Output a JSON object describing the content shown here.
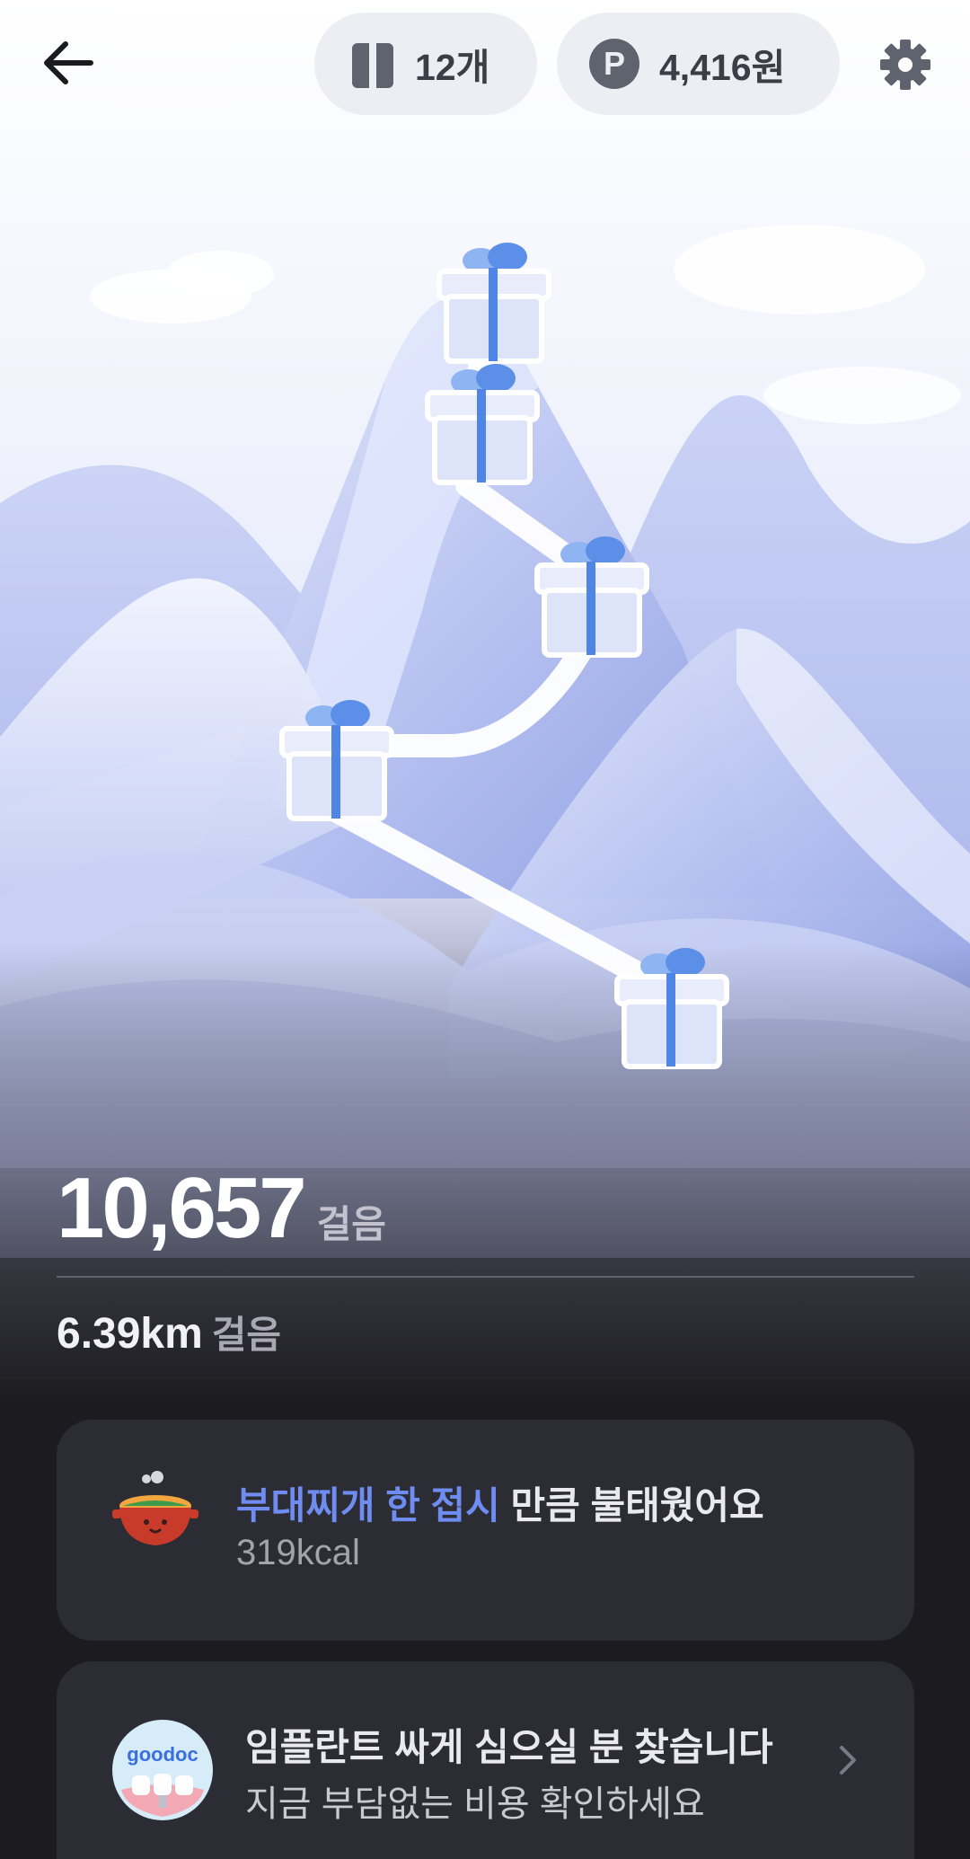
{
  "header": {
    "gift_count": "12개",
    "points": "4,416원",
    "points_badge": "P"
  },
  "stats": {
    "steps": "10,657",
    "steps_unit": "걸음",
    "distance": "6.39km",
    "distance_unit": "걸음"
  },
  "calorie_card": {
    "highlight": "부대찌개 한 접시",
    "rest": " 만큼 불태웠어요",
    "kcal": "319kcal"
  },
  "ad_card": {
    "logo_text": "goodoc",
    "title": "임플란트 싸게 심으실 분 찾습니다",
    "subtitle": "지금 부담없는 비용 확인하세요"
  },
  "colors": {
    "accent": "#6f8cf0",
    "background": "#1c1c20",
    "card": "#2b2c34",
    "gift_ribbon": "#4f86e6"
  },
  "icons": [
    "back-arrow-icon",
    "gift-box-icon",
    "points-badge-icon",
    "gear-icon",
    "stew-pot-icon",
    "goodoc-logo-icon",
    "chevron-right-icon"
  ]
}
